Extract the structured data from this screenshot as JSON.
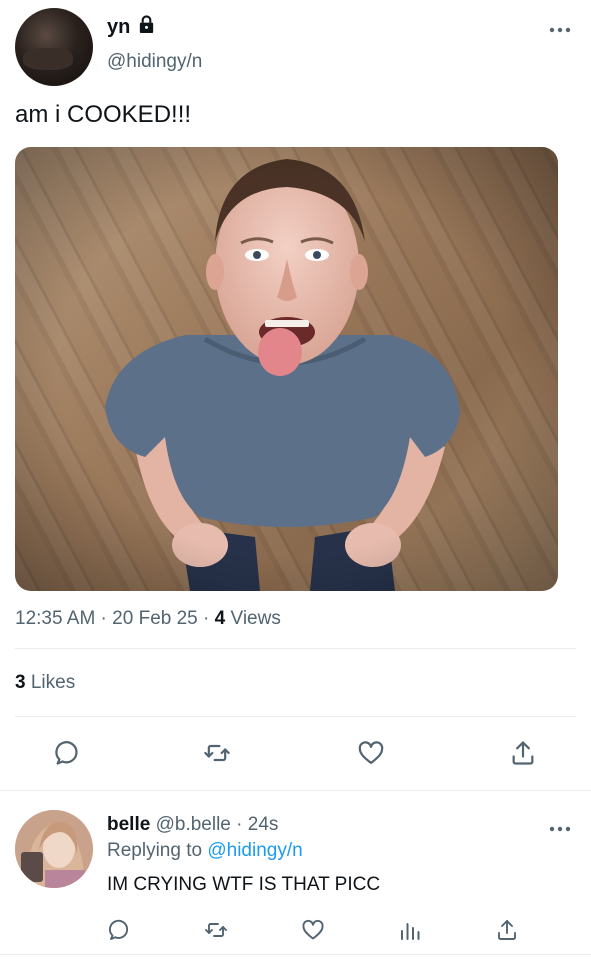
{
  "tweet": {
    "author_name": "yn",
    "author_handle": "@hidingy/n",
    "text": "am i COOKED!!!",
    "time": "12:35 AM",
    "sep1": " · ",
    "date": "20 Feb 25",
    "sep2": " · ",
    "views_count": "4",
    "views_label": " Views",
    "likes_count": "3",
    "likes_label": " Likes",
    "icons": [
      "lock-icon",
      "more-icon"
    ]
  },
  "actions": [
    "reply-icon",
    "retweet-icon",
    "like-icon",
    "share-icon"
  ],
  "reply": {
    "author_name": "belle",
    "author_handle": " @b.belle",
    "sep": " · ",
    "age": "24s",
    "replying_prefix": "Replying to ",
    "replying_mention": "@hidingy/n",
    "text": "IM CRYING WTF IS THAT PICC",
    "actions": [
      "reply-icon",
      "retweet-icon",
      "like-icon",
      "views-icon",
      "share-icon"
    ]
  },
  "colors": {
    "text": "#0f1419",
    "secondary": "#536471",
    "link": "#1d9bf0",
    "divider": "#e6ecf0"
  }
}
